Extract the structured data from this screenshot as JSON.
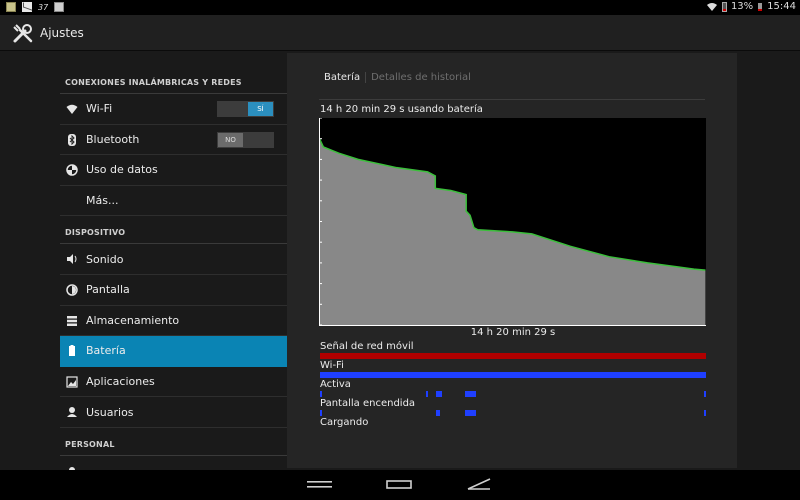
{
  "status_bar": {
    "left_icons": [
      "notification-icon",
      "gmail-icon",
      "network-37-icon",
      "image-icon"
    ],
    "indicator_37": "37",
    "battery_percent": "13%",
    "time": "15:44"
  },
  "action_bar": {
    "title": "Ajustes",
    "icon": "tools-icon"
  },
  "sidebar": {
    "sections": [
      {
        "header": "CONEXIONES INALÁMBRICAS Y REDES",
        "items": [
          {
            "label": "Wi-Fi",
            "icon": "wifi-icon",
            "toggle": "SÍ",
            "toggle_on": true
          },
          {
            "label": "Bluetooth",
            "icon": "bluetooth-icon",
            "toggle": "NO",
            "toggle_on": false
          },
          {
            "label": "Uso de datos",
            "icon": "data-usage-icon"
          },
          {
            "label": "Más...",
            "icon": ""
          }
        ]
      },
      {
        "header": "DISPOSITIVO",
        "items": [
          {
            "label": "Sonido",
            "icon": "speaker-icon"
          },
          {
            "label": "Pantalla",
            "icon": "brightness-icon"
          },
          {
            "label": "Almacenamiento",
            "icon": "storage-icon"
          },
          {
            "label": "Batería",
            "icon": "battery-icon",
            "selected": true
          },
          {
            "label": "Aplicaciones",
            "icon": "apps-icon"
          },
          {
            "label": "Usuarios",
            "icon": "user-icon"
          }
        ]
      },
      {
        "header": "PERSONAL",
        "items": []
      }
    ]
  },
  "battery_panel": {
    "tabs": [
      {
        "label": "Batería",
        "active": true
      },
      {
        "label": "Detalles de historial",
        "active": false
      }
    ],
    "usage_title": "14 h 20 min 29 s usando batería",
    "x_label": "14 h 20 min 29 s",
    "signal_rows": [
      {
        "label": "Señal de red móvil",
        "color": "#b00000"
      },
      {
        "label": "Wi-Fi",
        "color": "#1f3fff"
      },
      {
        "label": "Activa",
        "color": "#1f3fff"
      },
      {
        "label": "Pantalla encendida",
        "color": "#1f3fff"
      },
      {
        "label": "Cargando",
        "color": "#1f3fff"
      }
    ]
  },
  "chart_data": {
    "type": "area",
    "title": "",
    "xlabel": "14 h 20 min 29 s",
    "ylabel": "",
    "x_unit": "fraction of elapsed time",
    "y_unit": "battery level (fraction)",
    "xlim": [
      0,
      1
    ],
    "ylim": [
      0,
      1
    ],
    "series": [
      {
        "fill_color": "#888888",
        "line_color": "#3bbf3b",
        "points": [
          [
            0.0,
            0.9
          ],
          [
            0.01,
            0.86
          ],
          [
            0.05,
            0.83
          ],
          [
            0.1,
            0.8
          ],
          [
            0.2,
            0.76
          ],
          [
            0.28,
            0.74
          ],
          [
            0.3,
            0.72
          ],
          [
            0.3,
            0.66
          ],
          [
            0.34,
            0.65
          ],
          [
            0.38,
            0.63
          ],
          [
            0.38,
            0.55
          ],
          [
            0.39,
            0.53
          ],
          [
            0.4,
            0.47
          ],
          [
            0.41,
            0.46
          ],
          [
            0.5,
            0.45
          ],
          [
            0.55,
            0.44
          ],
          [
            0.65,
            0.38
          ],
          [
            0.75,
            0.33
          ],
          [
            0.85,
            0.3
          ],
          [
            0.93,
            0.28
          ],
          [
            0.97,
            0.27
          ],
          [
            1.0,
            0.265
          ]
        ]
      }
    ],
    "signal_segments": {
      "Señal de red móvil": [
        [
          0.0,
          1.0
        ]
      ],
      "Wi-Fi": [
        [
          0.0,
          1.0
        ]
      ],
      "Activa": [
        [
          0.0,
          0.005
        ],
        [
          0.275,
          0.28
        ],
        [
          0.3,
          0.315
        ],
        [
          0.375,
          0.405
        ],
        [
          0.995,
          1.0
        ]
      ],
      "Pantalla encendida": [
        [
          0.0,
          0.005
        ],
        [
          0.3,
          0.31
        ],
        [
          0.375,
          0.405
        ],
        [
          0.995,
          1.0
        ]
      ],
      "Cargando": []
    }
  }
}
